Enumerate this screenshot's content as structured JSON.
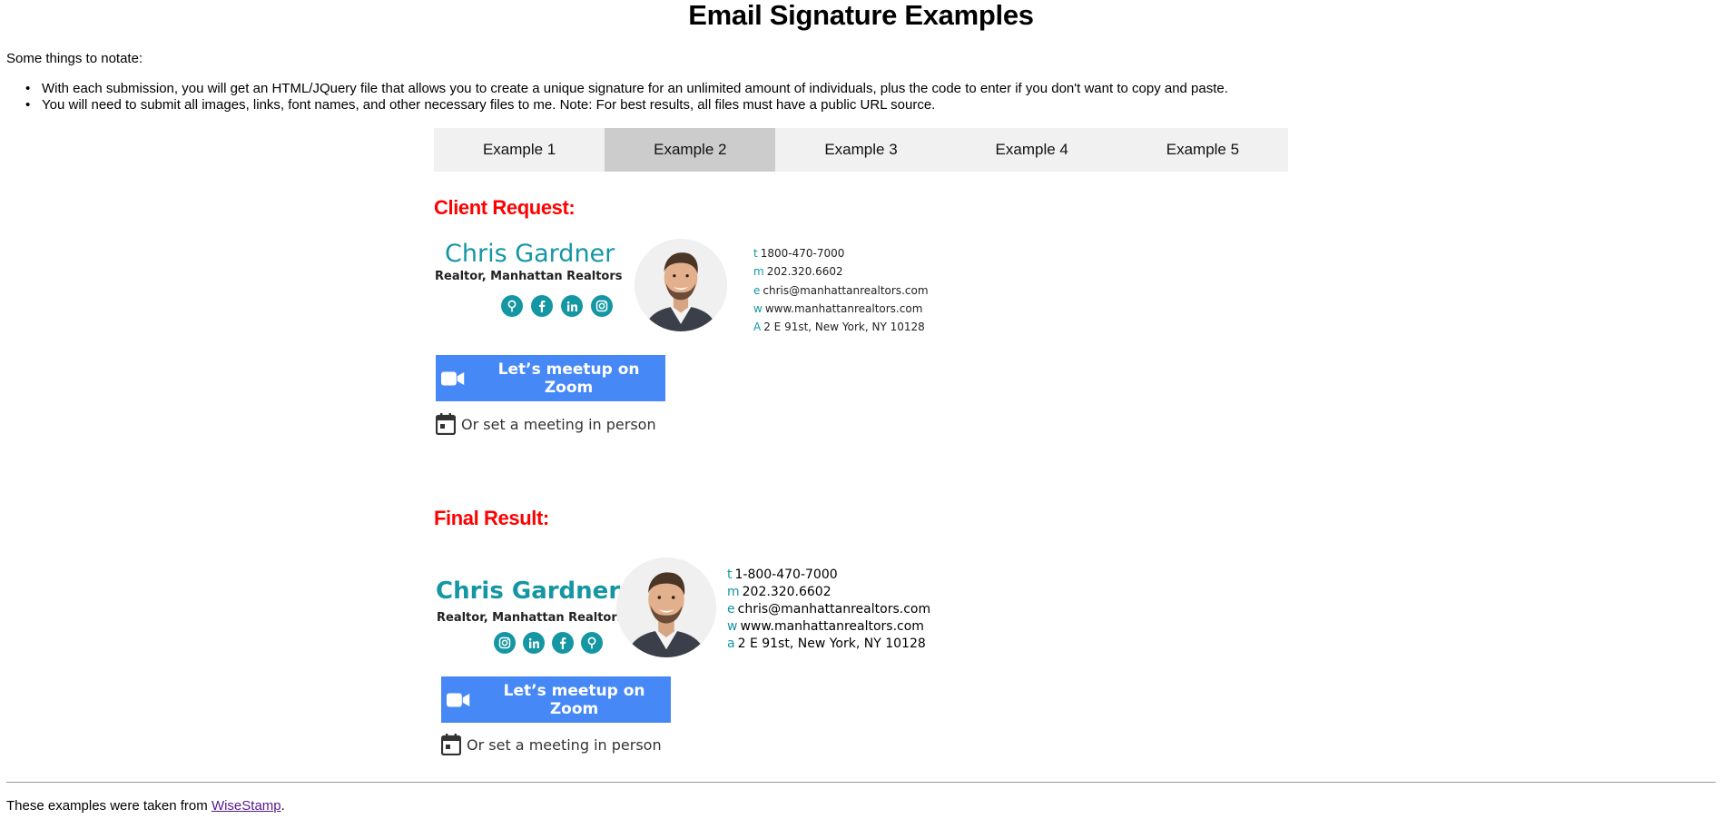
{
  "page": {
    "title": "Email Signature Examples",
    "intro": "Some things to notate:",
    "notes": [
      "With each submission, you will get an HTML/JQuery file that allows you to create a unique signature for an unlimited amount of individuals, plus the code to enter if you don't want to copy and paste.",
      "You will need to submit all images, links, font names, and other necessary files to me. Note: For best results, all files must have a public URL source."
    ]
  },
  "tabs": [
    {
      "label": "Example 1",
      "active": false
    },
    {
      "label": "Example 2",
      "active": true
    },
    {
      "label": "Example 3",
      "active": false
    },
    {
      "label": "Example 4",
      "active": false
    },
    {
      "label": "Example 5",
      "active": false
    }
  ],
  "client_request": {
    "heading": "Client Request:",
    "name": "Chris Gardner",
    "role": "Realtor, Manhattan Realtors",
    "social_icons": [
      "map-pin-icon",
      "facebook-icon",
      "linkedin-icon",
      "instagram-icon"
    ],
    "contact": [
      {
        "key": "t",
        "value": "1800-470-7000"
      },
      {
        "key": "m",
        "value": "202.320.6602"
      },
      {
        "key": "e",
        "value": "chris@manhattanrealtors.com"
      },
      {
        "key": "w",
        "value": "www.manhattanrealtors.com"
      },
      {
        "key": "A",
        "value": "2 E 91st, New York, NY 10128"
      }
    ],
    "zoom_label": "Let’s meetup on Zoom",
    "meeting_label": "Or set a meeting in person"
  },
  "final_result": {
    "heading": "Final Result:",
    "name": "Chris Gardner",
    "role": "Realtor, Manhattan Realtors",
    "social_icons": [
      "instagram-icon",
      "linkedin-icon",
      "facebook-icon",
      "map-pin-icon"
    ],
    "contact": [
      {
        "key": "t",
        "value": "1-800-470-7000"
      },
      {
        "key": "m",
        "value": "202.320.6602"
      },
      {
        "key": "e",
        "value": "chris@manhattanrealtors.com"
      },
      {
        "key": "w",
        "value": "www.manhattanrealtors.com"
      },
      {
        "key": "a",
        "value": "2 E 91st, New York, NY 10128"
      }
    ],
    "zoom_label": "Let’s meetup on Zoom",
    "meeting_label": "Or set a meeting in person"
  },
  "footer": {
    "prefix": "These examples were taken from ",
    "link_text": "WiseStamp",
    "suffix": "."
  },
  "colors": {
    "accent_teal": "#1596a3",
    "heading_red": "#ff0000",
    "zoom_blue": "#4689f6",
    "tab_active": "#cccccc",
    "tab_bar": "#f1f1f1"
  }
}
